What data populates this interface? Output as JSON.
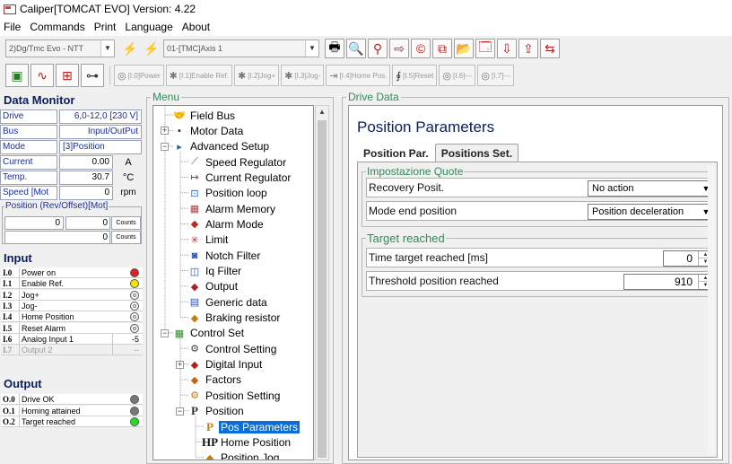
{
  "window": {
    "title": "Caliper[TOMCAT EVO] Version: 4.22"
  },
  "menubar": [
    "File",
    "Commands",
    "Print",
    "Language",
    "About"
  ],
  "toolbar": {
    "device_combo": "2)Dg/Tmc Evo - NTT",
    "axis_combo": "01-[TMC]Axis 1",
    "axis_buttons": [
      "[I.0]Power",
      "[I.1]Enable Ref.",
      "[I.2]Jog+",
      "[I.3]Jog-",
      "[I.4]Home Pos.",
      "[I.5]Reset",
      "[I.6]---",
      "[I.7]---"
    ]
  },
  "data_monitor": {
    "title": "Data Monitor",
    "rows": [
      {
        "label": "Drive",
        "value": "6,0-12,0 [230 V]",
        "unit": ""
      },
      {
        "label": "Bus",
        "value": "Input/OutPut",
        "unit": ""
      },
      {
        "label": "Mode",
        "value": "[3]Position",
        "unit": ""
      },
      {
        "label": "Current",
        "value": "0.00",
        "unit": "A"
      },
      {
        "label": "Temp.",
        "value": "30.7",
        "unit": "°C"
      },
      {
        "label": "Speed [Mot",
        "value": "0",
        "unit": "rpm"
      }
    ],
    "position": {
      "legend": "Position (Rev/Offset)[Mot]",
      "rev": "0",
      "offset": "0",
      "unit1": "Counts",
      "value2": "0",
      "unit2": "Counts"
    }
  },
  "input": {
    "title": "Input",
    "items": [
      {
        "num": "I.0",
        "label": "Power on",
        "state": "red",
        "value": ""
      },
      {
        "num": "I.1",
        "label": "Enable Ref.",
        "state": "yellow",
        "value": ""
      },
      {
        "num": "I.2",
        "label": "Jog+",
        "state": "off",
        "value": ""
      },
      {
        "num": "I.3",
        "label": "Jog-",
        "state": "off",
        "value": ""
      },
      {
        "num": "I.4",
        "label": "Home Position",
        "state": "off",
        "value": ""
      },
      {
        "num": "I.5",
        "label": "Reset Alarm",
        "state": "off",
        "value": ""
      },
      {
        "num": "I.6",
        "label": "Analog Input 1",
        "state": "value",
        "value": "-5"
      },
      {
        "num": "I.7",
        "label": "Output 2",
        "state": "disabled",
        "value": "--"
      }
    ]
  },
  "output": {
    "title": "Output",
    "items": [
      {
        "num": "O.0",
        "label": "Drive OK",
        "state": "gray"
      },
      {
        "num": "O.1",
        "label": "Homing attained",
        "state": "gray"
      },
      {
        "num": "O.2",
        "label": "Target reached",
        "state": "green"
      }
    ]
  },
  "menu": {
    "title": "Menu",
    "tree": [
      {
        "label": "Field Bus",
        "icon": "handshake-icon",
        "glyph": "🤝"
      },
      {
        "label": "Motor Data",
        "icon": "motor-icon",
        "glyph": "▪"
      },
      {
        "label": "Advanced Setup",
        "icon": "setup-icon",
        "glyph": "▸"
      },
      {
        "label": "Speed Regulator",
        "icon": "speed-chart-icon",
        "glyph": "⟋"
      },
      {
        "label": "Current Regulator",
        "icon": "current-icon",
        "glyph": "↦"
      },
      {
        "label": "Position loop",
        "icon": "position-loop-icon",
        "glyph": "⊡"
      },
      {
        "label": "Alarm Memory",
        "icon": "memory-icon",
        "glyph": "▦"
      },
      {
        "label": "Alarm Mode",
        "icon": "alarm-icon",
        "glyph": "◆"
      },
      {
        "label": "Limit",
        "icon": "limit-icon",
        "glyph": "✳"
      },
      {
        "label": "Notch Filter",
        "icon": "notch-filter-icon",
        "glyph": "◙"
      },
      {
        "label": "Iq Filter",
        "icon": "iq-filter-icon",
        "glyph": "◫"
      },
      {
        "label": "Output",
        "icon": "output-icon",
        "glyph": "◆"
      },
      {
        "label": "Generic data",
        "icon": "table-icon",
        "glyph": "▤"
      },
      {
        "label": "Braking resistor",
        "icon": "resistor-icon",
        "glyph": "◆"
      },
      {
        "label": "Control Set",
        "icon": "control-set-icon",
        "glyph": "▦"
      },
      {
        "label": "Control Setting",
        "icon": "control-setting-icon",
        "glyph": "⚙"
      },
      {
        "label": "Digital Input",
        "icon": "digital-input-icon",
        "glyph": "◆"
      },
      {
        "label": "Factors",
        "icon": "factors-icon",
        "glyph": "◆"
      },
      {
        "label": "Position Setting",
        "icon": "position-setting-icon",
        "glyph": "⚙"
      },
      {
        "label": "Position",
        "icon": "position-icon",
        "glyph": "P"
      },
      {
        "label": "Pos Parameters",
        "icon": "pos-parameters-icon",
        "glyph": "P"
      },
      {
        "label": "Home Position",
        "icon": "home-position-icon",
        "glyph": "HP"
      },
      {
        "label": "Position Jog",
        "icon": "position-jog-icon",
        "glyph": "◆"
      }
    ]
  },
  "drive": {
    "title": "Drive Data",
    "heading": "Position Parameters",
    "tabs": [
      "Position Par.",
      "Positions Set."
    ],
    "group1": {
      "title": "Impostazione Quote",
      "recovery_label": "Recovery Posit.",
      "recovery_value": "No action",
      "mode_end_label": "Mode end position",
      "mode_end_value": "Position deceleration"
    },
    "group2": {
      "title": "Target reached",
      "time_label": "Time target reached [ms]",
      "time_value": "0",
      "threshold_label": "Threshold position reached",
      "threshold_value": "910"
    }
  },
  "colors": {
    "title_blue": "#0a1f5e",
    "legend_green": "#2e8b57",
    "label_blue": "#1a2e9a",
    "selection": "#0b6dd6",
    "led_red": "#e02020",
    "led_yellow": "#f2e600",
    "led_green": "#22dd22",
    "led_gray": "#777777"
  }
}
